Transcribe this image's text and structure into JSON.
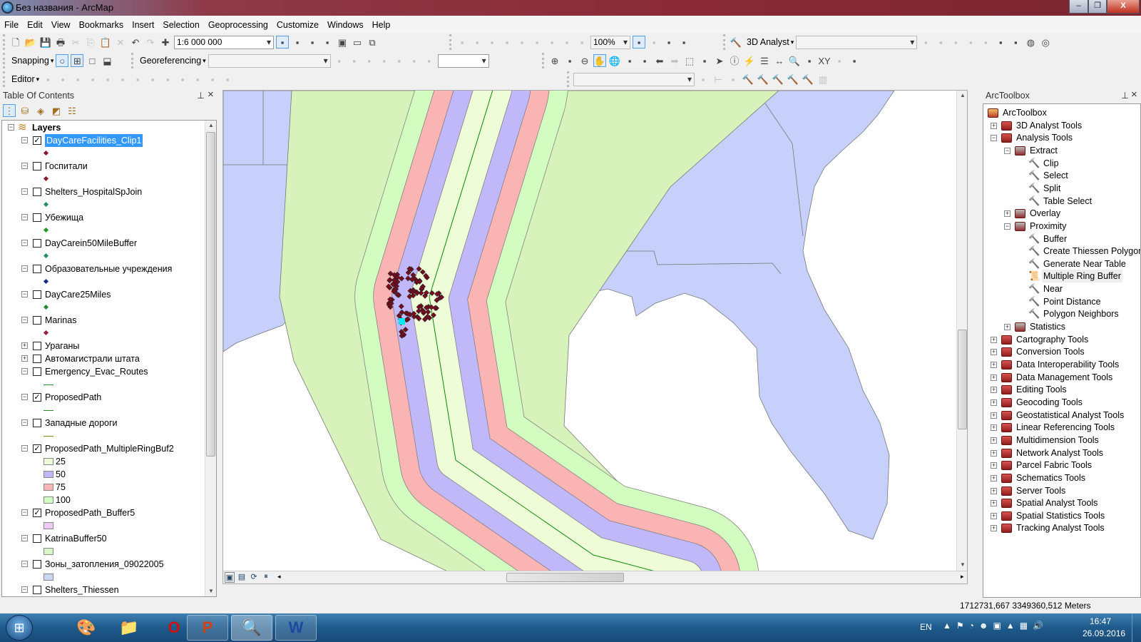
{
  "window": {
    "title": "Без названия - ArcMap",
    "min": "–",
    "max": "❐",
    "close": "X"
  },
  "menu": [
    "File",
    "Edit",
    "View",
    "Bookmarks",
    "Insert",
    "Selection",
    "Geoprocessing",
    "Customize",
    "Windows",
    "Help"
  ],
  "toolbars": {
    "standard": {
      "icons1": [
        "new-document",
        "open",
        "save",
        "print",
        "cut",
        "copy",
        "paste",
        "delete",
        "undo",
        "redo",
        "add-data"
      ],
      "scale": "1:6 000 000",
      "icons2": [
        "editor-toolbar",
        "table-of-contents",
        "catalog",
        "search",
        "arctoolbox",
        "python",
        "modelbuilder"
      ]
    },
    "layout": {
      "icons": [
        "zoom-in-page",
        "zoom-out-page",
        "pan-page",
        "zoom-whole-page",
        "zoom-100",
        "fixed-zoom-in",
        "fixed-zoom-out",
        "back-extent",
        "forward-extent"
      ],
      "zoom": "100%",
      "icons2": [
        "toggle-draft",
        "focus-data-frame",
        "change-layout",
        "data-driven-pages"
      ]
    },
    "analyst3d": {
      "label": "3D Analyst",
      "layer": "",
      "icons": [
        "contour",
        "steepest-path",
        "line-of-sight",
        "profile-graph",
        "create-tin",
        "interpolate-point",
        "add-xy",
        "arcscene",
        "arcglobe"
      ]
    },
    "snapping": {
      "label": "Snapping",
      "icons": [
        "point-snapping",
        "end-snapping",
        "vertex-snapping",
        "edge-snapping"
      ]
    },
    "georef": {
      "label": "Georeferencing",
      "layer": "",
      "icons": [
        "add-control-points",
        "auto-registration",
        "update-georef",
        "view-link-table",
        "rotate",
        "shift",
        "scale-box"
      ],
      "value": ""
    },
    "tools": {
      "icons": [
        "zoom-in",
        "zoom-out-fixed",
        "zoom-out",
        "pan",
        "full-extent",
        "fixed-zoom-in-map",
        "fixed-zoom-out-map",
        "go-back",
        "go-forward",
        "select-features",
        "clear-selection",
        "select-elements",
        "identify",
        "hyperlink",
        "html-popup",
        "measure",
        "find",
        "find-route",
        "goto-xy",
        "time-slider",
        "create-viewer-window"
      ]
    },
    "editor": {
      "label": "Editor",
      "icons": [
        "edit-tool",
        "edit-annotation",
        "straight-segment",
        "end-point-arc",
        "trace",
        "midpoint",
        "cut-polygons",
        "reshape",
        "split",
        "rotate-edit",
        "attributes",
        "sketch-properties",
        "create-features"
      ]
    },
    "spatial": {
      "layer": "",
      "icons": [
        "contour-sa",
        "histogram-line",
        "create-point",
        "hammer-1",
        "hammer-2",
        "hammer-3",
        "hammer-4",
        "hammer-5",
        "histogram"
      ]
    }
  },
  "toc": {
    "title": "Table Of Contents",
    "pin": "⊥",
    "close": "×",
    "tabs": [
      "list-by-drawing-order",
      "list-by-source",
      "list-by-visibility",
      "list-by-selection",
      "options"
    ],
    "root": "Layers",
    "layers": [
      {
        "name": "DayCareFacilities_Clip1",
        "checked": true,
        "expanded": true,
        "selected": true,
        "legend": [
          {
            "type": "point",
            "color": "#8b1a2a"
          }
        ]
      },
      {
        "name": "Госпитали",
        "checked": false,
        "expanded": true,
        "legend": [
          {
            "type": "point",
            "color": "#8b1a2a"
          }
        ]
      },
      {
        "name": "Shelters_HospitalSpJoin",
        "checked": false,
        "expanded": true,
        "legend": [
          {
            "type": "point",
            "color": "#2a8a7a"
          }
        ]
      },
      {
        "name": "Убежища",
        "checked": false,
        "expanded": true,
        "legend": [
          {
            "type": "point",
            "color": "#229922"
          }
        ]
      },
      {
        "name": "DayCarein50MileBuffer",
        "checked": false,
        "expanded": true,
        "legend": [
          {
            "type": "point",
            "color": "#2a8a7a"
          }
        ]
      },
      {
        "name": "Образовательные учреждения",
        "checked": false,
        "expanded": true,
        "legend": [
          {
            "type": "point",
            "color": "#1a2a8a"
          }
        ]
      },
      {
        "name": "DayCare25Miles",
        "checked": false,
        "expanded": true,
        "legend": [
          {
            "type": "point",
            "color": "#228a33"
          }
        ]
      },
      {
        "name": "Marinas",
        "checked": false,
        "expanded": true,
        "legend": [
          {
            "type": "point",
            "color": "#9a1a4a"
          }
        ]
      },
      {
        "name": "Ураганы",
        "checked": false,
        "expanded": false,
        "legend": []
      },
      {
        "name": "Автомагистрали штата",
        "checked": false,
        "expanded": false,
        "legend": []
      },
      {
        "name": "Emergency_Evac_Routes",
        "checked": false,
        "expanded": true,
        "legend": [
          {
            "type": "line",
            "color": "#2a8a2a"
          }
        ]
      },
      {
        "name": "ProposedPath",
        "checked": true,
        "expanded": true,
        "legend": [
          {
            "type": "line",
            "color": "#2a8a2a"
          }
        ]
      },
      {
        "name": "Западные дороги",
        "checked": false,
        "expanded": true,
        "legend": [
          {
            "type": "line",
            "color": "#7a8a2a"
          }
        ]
      },
      {
        "name": "ProposedPath_MultipleRingBuf2",
        "checked": true,
        "expanded": true,
        "legend": [
          {
            "type": "fill",
            "color": "#eefcd8",
            "label": "25"
          },
          {
            "type": "fill",
            "color": "#c0b8f8",
            "label": "50"
          },
          {
            "type": "fill",
            "color": "#fbb4b4",
            "label": "75"
          },
          {
            "type": "fill",
            "color": "#d2fcc0",
            "label": "100"
          }
        ]
      },
      {
        "name": "ProposedPath_Buffer5",
        "checked": true,
        "expanded": true,
        "legend": [
          {
            "type": "fill",
            "color": "#ecccf2"
          }
        ]
      },
      {
        "name": "KatrinaBuffer50",
        "checked": false,
        "expanded": true,
        "legend": [
          {
            "type": "fill",
            "color": "#d8f4c8"
          }
        ]
      },
      {
        "name": "Зоны_затопления_09022005",
        "checked": false,
        "expanded": true,
        "legend": [
          {
            "type": "fill",
            "color": "#ccd8f8"
          }
        ]
      },
      {
        "name": "Shelters_Thiessen",
        "checked": false,
        "expanded": true,
        "legend": []
      }
    ]
  },
  "map": {
    "colors": {
      "land": "#c6d0fa",
      "ring25": "#eefcd8",
      "ring50": "#c0b8f8",
      "ring75": "#fbb4b4",
      "ring100": "#d2fcc0",
      "buffer": "#d8f2bc",
      "path": "#0a8a0a",
      "points": "#7a0a1e",
      "highlight": "#00e8f0"
    },
    "nav": [
      "layout-view",
      "data-view",
      "refresh",
      "pause-drawing"
    ]
  },
  "toolbox": {
    "title": "ArcToolbox",
    "pin": "⊥",
    "close": "×",
    "items": [
      {
        "label": "ArcToolbox",
        "level": 0,
        "kind": "root"
      },
      {
        "label": "3D Analyst Tools",
        "level": 1,
        "kind": "box",
        "exp": "+"
      },
      {
        "label": "Analysis Tools",
        "level": 1,
        "kind": "box",
        "exp": "−"
      },
      {
        "label": "Extract",
        "level": 2,
        "kind": "set",
        "exp": "−"
      },
      {
        "label": "Clip",
        "level": 3,
        "kind": "tool"
      },
      {
        "label": "Select",
        "level": 3,
        "kind": "tool"
      },
      {
        "label": "Split",
        "level": 3,
        "kind": "tool"
      },
      {
        "label": "Table Select",
        "level": 3,
        "kind": "tool"
      },
      {
        "label": "Overlay",
        "level": 2,
        "kind": "set",
        "exp": "+"
      },
      {
        "label": "Proximity",
        "level": 2,
        "kind": "set",
        "exp": "−"
      },
      {
        "label": "Buffer",
        "level": 3,
        "kind": "tool"
      },
      {
        "label": "Create Thiessen Polygons",
        "level": 3,
        "kind": "tool"
      },
      {
        "label": "Generate Near Table",
        "level": 3,
        "kind": "tool"
      },
      {
        "label": "Multiple Ring Buffer",
        "level": 3,
        "kind": "script",
        "hover": true
      },
      {
        "label": "Near",
        "level": 3,
        "kind": "tool"
      },
      {
        "label": "Point Distance",
        "level": 3,
        "kind": "tool"
      },
      {
        "label": "Polygon Neighbors",
        "level": 3,
        "kind": "tool"
      },
      {
        "label": "Statistics",
        "level": 2,
        "kind": "set",
        "exp": "+"
      },
      {
        "label": "Cartography Tools",
        "level": 1,
        "kind": "box",
        "exp": "+"
      },
      {
        "label": "Conversion Tools",
        "level": 1,
        "kind": "box",
        "exp": "+"
      },
      {
        "label": "Data Interoperability Tools",
        "level": 1,
        "kind": "box",
        "exp": "+"
      },
      {
        "label": "Data Management Tools",
        "level": 1,
        "kind": "box",
        "exp": "+"
      },
      {
        "label": "Editing Tools",
        "level": 1,
        "kind": "box",
        "exp": "+"
      },
      {
        "label": "Geocoding Tools",
        "level": 1,
        "kind": "box",
        "exp": "+"
      },
      {
        "label": "Geostatistical Analyst Tools",
        "level": 1,
        "kind": "box",
        "exp": "+"
      },
      {
        "label": "Linear Referencing Tools",
        "level": 1,
        "kind": "box",
        "exp": "+"
      },
      {
        "label": "Multidimension Tools",
        "level": 1,
        "kind": "box",
        "exp": "+"
      },
      {
        "label": "Network Analyst Tools",
        "level": 1,
        "kind": "box",
        "exp": "+"
      },
      {
        "label": "Parcel Fabric Tools",
        "level": 1,
        "kind": "box",
        "exp": "+"
      },
      {
        "label": "Schematics Tools",
        "level": 1,
        "kind": "box",
        "exp": "+"
      },
      {
        "label": "Server Tools",
        "level": 1,
        "kind": "box",
        "exp": "+"
      },
      {
        "label": "Spatial Analyst Tools",
        "level": 1,
        "kind": "box",
        "exp": "+"
      },
      {
        "label": "Spatial Statistics Tools",
        "level": 1,
        "kind": "box",
        "exp": "+"
      },
      {
        "label": "Tracking Analyst Tools",
        "level": 1,
        "kind": "box",
        "exp": "+"
      }
    ]
  },
  "status": {
    "coords": "1712731,667  3349360,512 Meters"
  },
  "taskbar": {
    "apps": [
      "paint",
      "explorer",
      "opera",
      "powerpoint",
      "arcmap",
      "word"
    ],
    "lang": "EN",
    "time": "16:47",
    "date": "26.09.2016",
    "tray": [
      "show-hidden",
      "action-center",
      "stopwatch",
      "app-error",
      "nvidia",
      "avira",
      "network",
      "volume"
    ]
  }
}
